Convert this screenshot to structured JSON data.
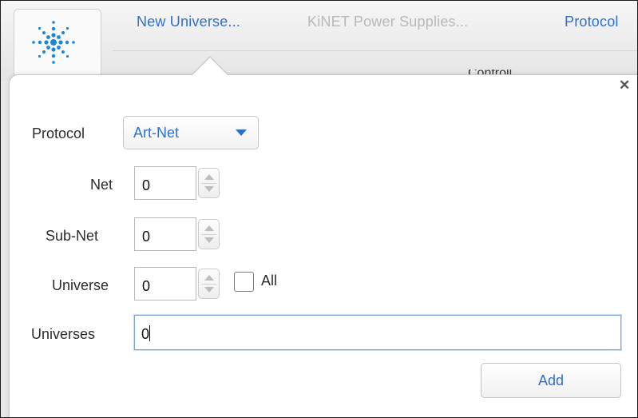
{
  "toolbar": {
    "logo_icon": "starburst-logo-icon",
    "tabs": [
      {
        "label": "New Universe...",
        "state": "active"
      },
      {
        "label": "KiNET Power Supplies...",
        "state": "disabled"
      },
      {
        "label": "Protocol",
        "state": "enabled"
      }
    ],
    "behind_text": "Controll"
  },
  "popover": {
    "close_icon": "close-icon",
    "protocol": {
      "label": "Protocol",
      "value": "Art-Net",
      "icon": "chevron-down-icon"
    },
    "net": {
      "label": "Net",
      "value": "0"
    },
    "subnet": {
      "label": "Sub-Net",
      "value": "0"
    },
    "universe": {
      "label": "Universe",
      "value": "0"
    },
    "all_checkbox": {
      "label": "All",
      "checked": false
    },
    "universes": {
      "label": "Universes",
      "value": "0"
    },
    "add_button": "Add"
  },
  "colors": {
    "accent": "#2a6fd1",
    "disabled_text": "#b8b8b8",
    "logo": "#1a86d8"
  }
}
